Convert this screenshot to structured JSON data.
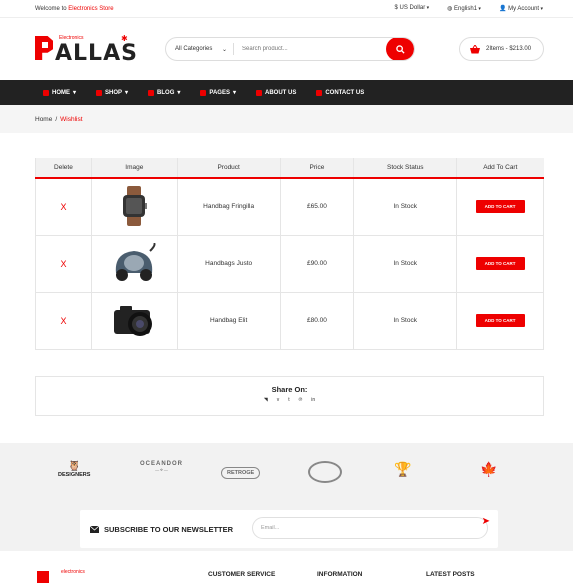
{
  "topbar": {
    "welcome_prefix": "Welcome to",
    "welcome_store": "Electronics Store",
    "currency": "US Dollar",
    "language": "English1",
    "account": "My Account"
  },
  "logo": {
    "word": "ALLAS",
    "sub": "Electronics"
  },
  "search": {
    "category": "All Categories",
    "placeholder": "Search product..."
  },
  "cart": {
    "summary": "2Items - $213.00"
  },
  "nav": [
    {
      "label": "HOME"
    },
    {
      "label": "SHOP"
    },
    {
      "label": "BLOG"
    },
    {
      "label": "PAGES"
    },
    {
      "label": "ABOUT US"
    },
    {
      "label": "CONTACT US"
    }
  ],
  "breadcrumb": {
    "home": "Home",
    "sep": "/",
    "current": "Wishlist"
  },
  "table": {
    "headers": [
      "Delete",
      "Image",
      "Product",
      "Price",
      "Stock Status",
      "Add To Cart"
    ],
    "rows": [
      {
        "delete": "X",
        "image": "smartwatch",
        "product": "Handbag Fringilla",
        "price": "£65.00",
        "stock": "In Stock",
        "cta": "ADD TO CART"
      },
      {
        "delete": "X",
        "image": "vacuum",
        "product": "Handbags Justo",
        "price": "£90.00",
        "stock": "In Stock",
        "cta": "ADD TO CART"
      },
      {
        "delete": "X",
        "image": "camera",
        "product": "Handbag Elit",
        "price": "£80.00",
        "stock": "In Stock",
        "cta": "ADD TO CART"
      }
    ]
  },
  "share": {
    "title": "Share On:",
    "icons": [
      "rss-icon",
      "vimeo-icon",
      "tumblr-icon",
      "pinterest-icon",
      "linkedin-icon"
    ]
  },
  "brands": [
    {
      "name": "DESIGNERS"
    },
    {
      "name": "OCEANDOR"
    },
    {
      "name": "RETROGE"
    },
    {
      "name": "BADGE"
    },
    {
      "name": "TROPHY"
    },
    {
      "name": "MAPLE"
    }
  ],
  "newsletter": {
    "title": "SUBSCRIBE TO OUR NEWSLETTER",
    "placeholder": "Email..."
  },
  "footer": {
    "columns": [
      "CUSTOMER SERVICE",
      "INFORMATION",
      "LATEST POSTS"
    ],
    "logo_sub": "electronics"
  },
  "colors": {
    "accent": "#e00000",
    "nav_bg": "#222222"
  }
}
